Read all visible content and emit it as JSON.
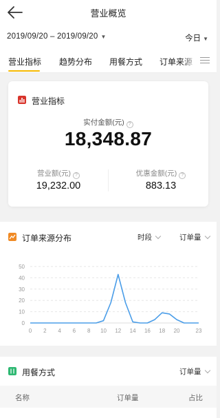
{
  "header": {
    "title": "营业概览"
  },
  "date_bar": {
    "range": "2019/09/20 – 2019/09/20",
    "period": "今日"
  },
  "tabs": [
    {
      "label": "营业指标"
    },
    {
      "label": "趋势分布"
    },
    {
      "label": "用餐方式"
    },
    {
      "label": "订单来源"
    }
  ],
  "metrics": {
    "title": "营业指标",
    "paid_label": "实付金额(元)",
    "paid_value": "18,348.87",
    "revenue_label": "营业额(元)",
    "revenue_value": "19,232.00",
    "discount_label": "优惠金额(元)",
    "discount_value": "883.13"
  },
  "order_source": {
    "title": "订单来源分布",
    "dim_select": "时段",
    "metric_select": "订单量"
  },
  "chart_data": {
    "type": "line",
    "x": [
      0,
      1,
      2,
      3,
      4,
      5,
      6,
      7,
      8,
      9,
      10,
      11,
      12,
      13,
      14,
      15,
      16,
      17,
      18,
      19,
      20,
      21,
      22,
      23
    ],
    "series": [
      {
        "values": [
          0,
          0,
          0,
          0,
          0,
          0,
          0,
          0,
          0,
          0,
          2,
          18,
          43,
          18,
          1,
          0,
          0,
          3,
          9,
          8,
          3,
          0,
          0,
          0
        ]
      }
    ],
    "x_ticks": [
      "0",
      "2",
      "4",
      "6",
      "8",
      "10",
      "12",
      "14",
      "16",
      "18",
      "20",
      "23"
    ],
    "y_ticks": [
      "0",
      "10",
      "20",
      "30",
      "40",
      "50"
    ],
    "ylim": [
      0,
      50
    ],
    "grid": "horizontal dashed",
    "color": "#4a9de8"
  },
  "dining": {
    "title": "用餐方式",
    "metric_select": "订单量",
    "columns": [
      "名称",
      "订单量",
      "占比"
    ]
  },
  "colors": {
    "accent": "#f5b800",
    "metrics_icon": "#d8342b",
    "orders_icon": "#f08a24",
    "dining_icon": "#2eb872",
    "line": "#4a9de8"
  }
}
